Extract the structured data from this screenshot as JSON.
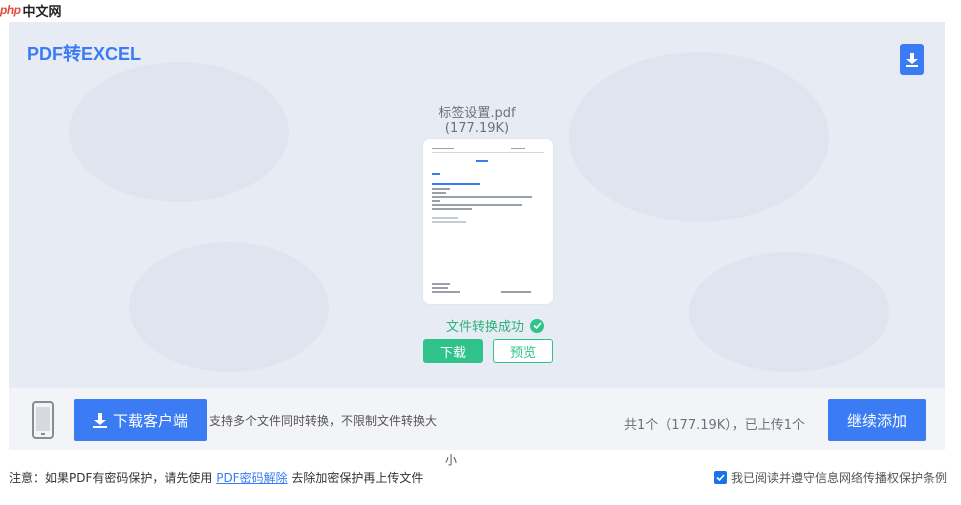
{
  "watermark": {
    "brand_php": "php",
    "brand_cn": "中文网"
  },
  "panel": {
    "title": "PDF转EXCEL",
    "file_name": "标签设置.pdf",
    "file_size": "(177.19K)",
    "status_text": "文件转换成功",
    "download_label": "下载",
    "preview_label": "预览"
  },
  "bottom_bar": {
    "client_button_label": "下载客户端",
    "support_text": "支持多个文件同时转换，不限制文件转换大",
    "support_text_wrap": "小",
    "count_text": "共1个（177.19K），已上传1个",
    "continue_button_label": "继续添加"
  },
  "footer": {
    "note_prefix": "注意：如果PDF有密码保护，请先使用 ",
    "note_link": "PDF密码解除",
    "note_suffix": " 去除加密保护再上传文件",
    "agree_text": "我已阅读并遵守信息网络传播权保护条例",
    "agree_checked": true
  },
  "colors": {
    "accent": "#3b7cf4",
    "success": "#2fc28a",
    "panel_bg": "#e7ecf4"
  },
  "icons": [
    "download-icon",
    "check-circle-icon",
    "phone-icon",
    "checkbox-icon"
  ]
}
